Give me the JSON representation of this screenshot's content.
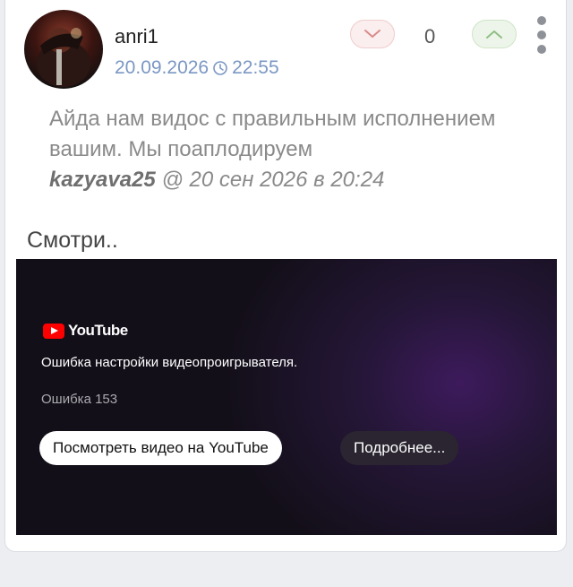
{
  "comment": {
    "username": "anri1",
    "date": "20.09.2026",
    "time": "22:55",
    "vote_count": "0",
    "quote": {
      "text": "Айда нам видос с правильным исполнением вашим. Мы поаплодируем",
      "author": "kazyava25",
      "meta": "@ 20 сен 2026 в 20:24"
    },
    "body": "Смотри.."
  },
  "video_embed": {
    "logo_text": "YouTube",
    "error_title": "Ошибка настройки видеопроигрывателя.",
    "error_code": "Ошибка 153",
    "watch_button": "Посмотреть видео на YouTube",
    "more_button": "Подробнее..."
  },
  "icons": {
    "avatar": "avatar",
    "clock": "clock-icon",
    "vote_down": "chevron-down-icon",
    "vote_up": "chevron-up-icon",
    "menu": "more-vertical-icon",
    "youtube_play": "youtube-play-icon"
  },
  "colors": {
    "date": "#7b97c4",
    "vote_down_bg": "#fbeeee",
    "vote_up_bg": "#edf5ea",
    "youtube_red": "#ff0000"
  }
}
